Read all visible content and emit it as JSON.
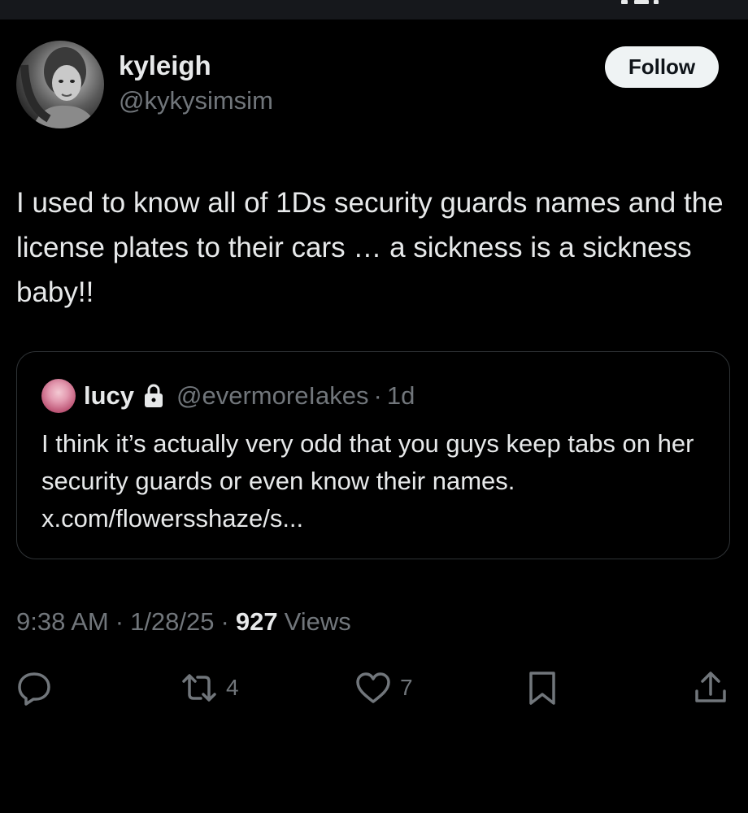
{
  "author": {
    "display_name": "kyleigh",
    "handle": "@kykysimsim",
    "avatar_icon": "profile-photo"
  },
  "follow_label": "Follow",
  "tweet": {
    "text": "I used to know all of 1Ds security guards names and the license plates to their cars … a sickness is a sickness baby!!"
  },
  "quote": {
    "name": "lucy",
    "lock_icon": "lock-icon",
    "handle": "@evermoreIakes",
    "separator": "·",
    "time": "1d",
    "text": "I think it’s actually very odd that you guys keep tabs on her security guards or even know their names. x.com/flowersshaze/s..."
  },
  "meta": {
    "time": "9:38 AM",
    "separator": "·",
    "date": "1/28/25",
    "views_count": "927",
    "views_label": "Views"
  },
  "actions": {
    "reply_icon": "reply-icon",
    "retweet_icon": "retweet-icon",
    "retweet_count": "4",
    "like_icon": "heart-icon",
    "like_count": "7",
    "bookmark_icon": "bookmark-icon",
    "share_icon": "share-icon"
  },
  "colors": {
    "background": "#000000",
    "primary_text": "#e7e9ea",
    "secondary_text": "#71767b",
    "border": "#2f3336",
    "follow_bg": "#eff3f4"
  }
}
